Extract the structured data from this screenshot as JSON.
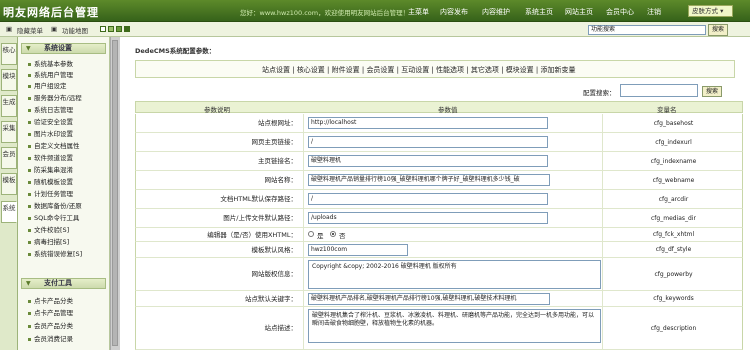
{
  "header": {
    "app_title": "明友网络后台管理",
    "welcome_text": "您好：www.hwz100.com，欢迎使用明友网站后台管理！",
    "nav": [
      "主菜单",
      "内容发布",
      "内容维护",
      "系统主页",
      "网站主页",
      "会员中心",
      "注销"
    ],
    "theme_button": "皮肤方式 ▾"
  },
  "subbar": {
    "hide_menu": "隐藏菜单",
    "function_map": "功能地图",
    "search_placeholder": "功能搜索",
    "search_button": "搜索"
  },
  "side_tabs": [
    "核心",
    "模块",
    "生成",
    "采集",
    "会员",
    "模板",
    "系统"
  ],
  "menu": {
    "system_settings_title": "系统设置",
    "system_items": [
      "系统基本参数",
      "系统用户管理",
      "用户组设定",
      "服务器分布/远程",
      "系统日志管理",
      "验证安全设置",
      "图片水印设置",
      "自定义文档属性",
      "软件频道设置",
      "防采集串混淆",
      "随机模板设置",
      "计划任务管理",
      "数据库备份/还原",
      "SQL命令行工具",
      "文件校验[S]",
      "病毒扫描[S]",
      "系统错误修复[S]"
    ],
    "payment_title": "支付工具",
    "payment_items": [
      "点卡产品分类",
      "点卡产品管理",
      "会员产品分类",
      "会员消费记录"
    ]
  },
  "main": {
    "section_title": "DedeCMS系统配置参数：",
    "tabs": [
      "站点设置",
      "核心设置",
      "附件设置",
      "会员设置",
      "互动设置",
      "性能选项",
      "其它选项",
      "模块设置",
      "添加新变量"
    ],
    "config_search_label": "配置搜索：",
    "config_search_button": "搜索",
    "columns": [
      "参数说明",
      "参数值",
      "变量名"
    ],
    "rows": [
      {
        "label": "站点根网址：",
        "value": "http://localhost",
        "var": "cfg_basehost"
      },
      {
        "label": "网页主页链接：",
        "value": "/",
        "var": "cfg_indexurl"
      },
      {
        "label": "主页链接名：",
        "value": "破壁料理机",
        "var": "cfg_indexname"
      },
      {
        "label": "网站名称：",
        "value": "破壁料理机产品销量排行榜10强_破壁料理机哪个牌子好_破壁料理机多少钱_破",
        "var": "cfg_webname"
      },
      {
        "label": "文档HTML默认保存路径：",
        "value": "/",
        "var": "cfg_arcdir"
      },
      {
        "label": "图片/上传文件默认路径：",
        "value": "/uploads",
        "var": "cfg_medias_dir"
      },
      {
        "label": "编辑器（是/否）使用XHTML：",
        "radio_yes": "是",
        "radio_no": "否",
        "selected": "否",
        "var": "cfg_fck_xhtml"
      },
      {
        "label": "模板默认风格：",
        "value": "hwz100com",
        "var": "cfg_df_style"
      },
      {
        "label": "网站版权信息：",
        "value": "Copyright &copy; 2002-2016 破壁料理机 版权所有",
        "var": "cfg_powerby"
      },
      {
        "label": "站点默认关键字：",
        "value": "破壁料理机产品排名,破壁料理机产品排行榜10强,破壁料理机,破壁技术料理机",
        "var": "cfg_keywords"
      },
      {
        "label": "站点描述：",
        "value": "破壁料理机集合了榨汁机、豆浆机、冰激凌机、料理机、研磨机等产品功能，完全达到一机多用功能，可以瞬间击破食物细胞壁，释放植物生化素的机器。",
        "var": "cfg_description"
      }
    ]
  }
}
